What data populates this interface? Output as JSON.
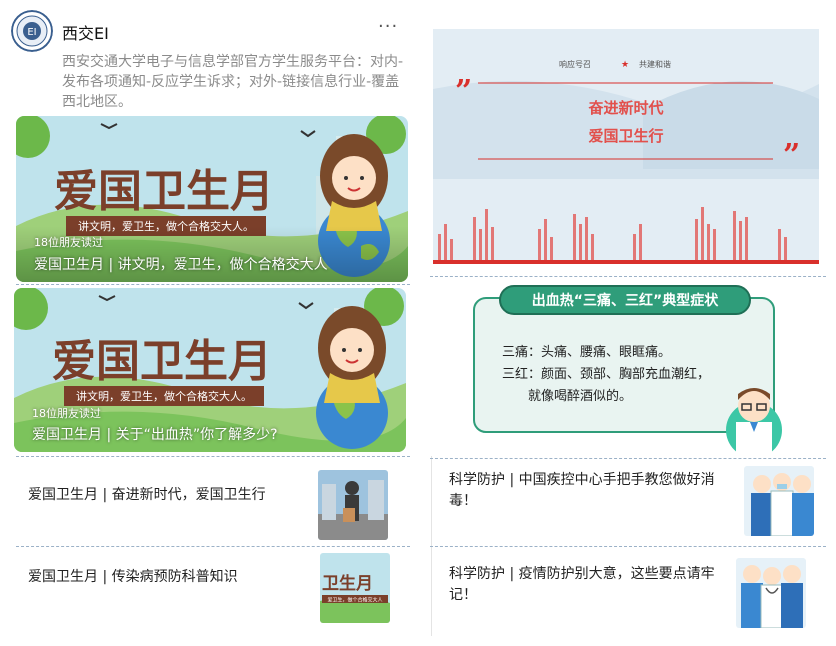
{
  "account": {
    "name": "西交EI",
    "description": "西安交通大学电子与信息学部官方学生服务平台：对内-发布各项通知-反应学生诉求；对外-链接信息行业-覆盖西北地区。",
    "more_label": "···"
  },
  "featured": [
    {
      "cover_title": "爱国卫生月",
      "cover_subtitle": "讲文明，爱卫生，做个合格交大人。",
      "reads": "18位朋友读过",
      "title": "爱国卫生月 | 讲文明，爱卫生，做个合格交大人"
    },
    {
      "cover_title": "爱国卫生月",
      "cover_subtitle": "讲文明，爱卫生，做个合格交大人。",
      "reads": "18位朋友读过",
      "title": "爱国卫生月 | 关于“出血热”你了解多少?"
    }
  ],
  "list_left": [
    {
      "title": "爱国卫生月 | 奋进新时代，爱国卫生行"
    },
    {
      "title": "爱国卫生月 | 传染病预防科普知识",
      "thumb_text": "卫生月",
      "thumb_sub": "爱卫生，做个合格交大人"
    }
  ],
  "poster": {
    "top_left": "响应号召",
    "star": "★",
    "top_right": "共建和谐",
    "line1": "奋进新时代",
    "line2": "爱国卫生行",
    "quote_open": "”",
    "quote_close": "”"
  },
  "symptoms": {
    "title": "出血热“三痛、三红”典型症状",
    "line1": "三痛：头痛、腰痛、眼眶痛。",
    "line2": "三红：颜面、颈部、胸部充血潮红，",
    "line3": "就像喝醉酒似的。"
  },
  "list_right": [
    {
      "title": "科学防护 | 中国疾控中心手把手教您做好消毒！"
    },
    {
      "title": "科学防护 | 疫情防护别大意，这些要点请牢记！"
    }
  ],
  "colors": {
    "accent_red": "#d9302c",
    "cover_green": "#7cc35c",
    "teal": "#2f9d7a"
  }
}
